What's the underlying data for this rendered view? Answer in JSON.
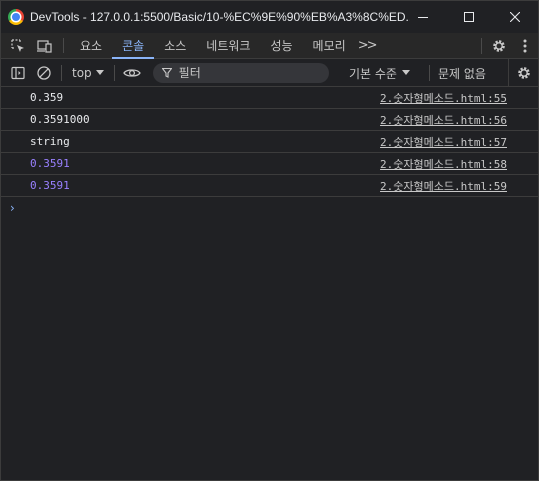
{
  "window": {
    "title": "DevTools - 127.0.0.1:5500/Basic/10-%EC%9E%90%EB%A3%8C%ED...",
    "minimize_icon": "minimize-icon",
    "maximize_icon": "maximize-icon",
    "close_icon": "close-icon"
  },
  "tabs": [
    {
      "label": "요소"
    },
    {
      "label": "콘솔",
      "active": true
    },
    {
      "label": "소스"
    },
    {
      "label": "네트워크"
    },
    {
      "label": "성능"
    },
    {
      "label": "메모리"
    }
  ],
  "tabbar": {
    "more_label": ">>"
  },
  "console_toolbar": {
    "context": "top",
    "filter_placeholder": "필터",
    "level": "기본 수준",
    "issues": "문제 없음"
  },
  "messages": [
    {
      "value": "0.359",
      "type": "string",
      "source": "2.숫자형메소드.html:55"
    },
    {
      "value": "0.3591000",
      "type": "string",
      "source": "2.숫자형메소드.html:56"
    },
    {
      "value": "string",
      "type": "string",
      "source": "2.숫자형메소드.html:57"
    },
    {
      "value": "0.3591",
      "type": "number",
      "source": "2.숫자형메소드.html:58"
    },
    {
      "value": "0.3591",
      "type": "number",
      "source": "2.숫자형메소드.html:59"
    }
  ],
  "prompt": "›",
  "colors": {
    "background": "#202124",
    "accent": "#8ab4f8",
    "number": "#9980ff",
    "text": "#e8eaed"
  }
}
